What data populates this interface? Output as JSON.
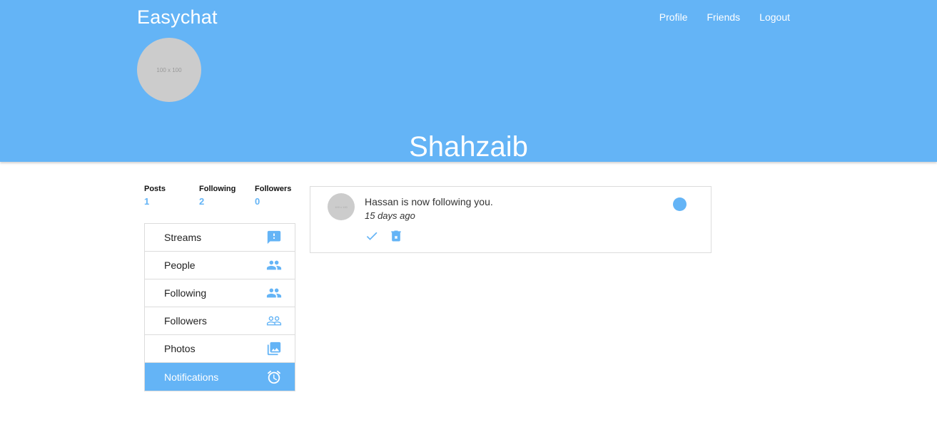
{
  "app": {
    "title": "Easychat"
  },
  "nav": {
    "profile": "Profile",
    "friends": "Friends",
    "logout": "Logout"
  },
  "profile": {
    "name": "Shahzaib",
    "avatar_placeholder": "100 x 100"
  },
  "stats": [
    {
      "label": "Posts",
      "value": "1"
    },
    {
      "label": "Following",
      "value": "2"
    },
    {
      "label": "Followers",
      "value": "0"
    }
  ],
  "menu": [
    {
      "label": "Streams",
      "icon": "feedback-icon"
    },
    {
      "label": "People",
      "icon": "people-icon"
    },
    {
      "label": "Following",
      "icon": "people-icon"
    },
    {
      "label": "Followers",
      "icon": "people-outline-icon"
    },
    {
      "label": "Photos",
      "icon": "photo-library-icon"
    },
    {
      "label": "Notifications",
      "icon": "alarm-icon",
      "active": true
    }
  ],
  "notification": {
    "text": "Hassan is now following you.",
    "time": "15 days ago",
    "avatar_placeholder": "100 x 100"
  },
  "colors": {
    "accent": "#64b4f6",
    "header": "#64b4f6",
    "border": "#dcdcdc"
  }
}
